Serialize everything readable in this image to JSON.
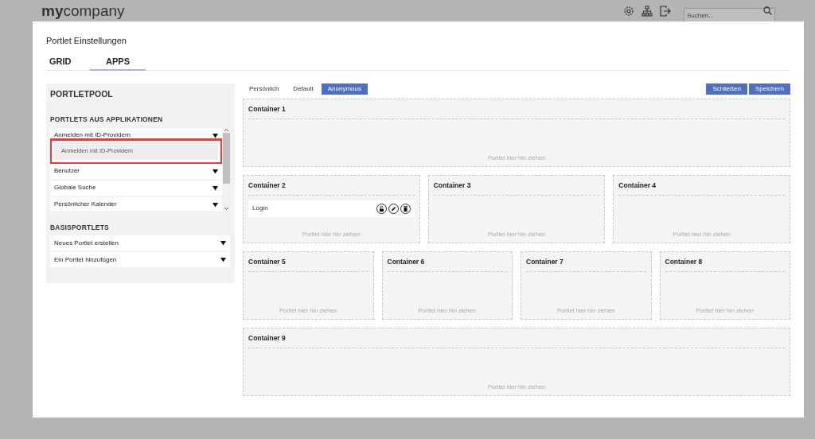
{
  "header": {
    "logo": "**my**company",
    "search": {
      "placeholder": "Suchen..."
    }
  },
  "dialog": {
    "title": "Portlet Einstellungen",
    "tabs": [
      {
        "label": "GRID",
        "selected": false
      },
      {
        "label": "APPS",
        "selected": true
      }
    ],
    "portletpool": {
      "title": "PORTLETPOOL",
      "sections": [
        {
          "title": "PORTLETS AUS APPLIKATIONEN",
          "scrollable": true,
          "items": [
            {
              "label": "Anmelden mit ID-Providern",
              "expanded": true,
              "children": [
                {
                  "label": "Anmelden mit ID-Providern",
                  "highlighted": true
                }
              ]
            },
            {
              "label": "Benutzer",
              "expanded": false
            },
            {
              "label": "Globale Suche",
              "expanded": false
            },
            {
              "label": "Persönlicher Kalender",
              "expanded": false
            }
          ]
        },
        {
          "title": "BASISPORTLETS",
          "scrollable": false,
          "items": [
            {
              "label": "Neues Portlet erstellen",
              "expanded": false
            },
            {
              "label": "Ein Portlet hinzufügen",
              "expanded": false
            }
          ]
        }
      ]
    },
    "views": [
      {
        "label": "Persönlich",
        "selected": false
      },
      {
        "label": "Default",
        "selected": false
      },
      {
        "label": "Anonymous",
        "selected": true
      }
    ],
    "buttons": [
      "Schließen",
      "Speichern"
    ],
    "container_rows": [
      [
        {
          "title": "Container 1",
          "placeholder": "Portlet hier hin ziehen"
        }
      ],
      [
        {
          "title": "Container 2",
          "portlets": [
            {
              "name": "Login"
            }
          ],
          "placeholder": "Portlet hier hin ziehen"
        },
        {
          "title": "Container 3",
          "placeholder": "Portlet hier hin ziehen"
        },
        {
          "title": "Container 4",
          "placeholder": "Portlet hier hin ziehen"
        }
      ],
      [
        {
          "title": "Container 5",
          "placeholder": "Portlet hier hin ziehen"
        },
        {
          "title": "Container 6",
          "placeholder": "Portlet hier hin ziehen"
        },
        {
          "title": "Container 7",
          "placeholder": "Portlet hier hin ziehen"
        },
        {
          "title": "Container 8",
          "placeholder": "Portlet hier hin ziehen"
        }
      ],
      [
        {
          "title": "Container 9",
          "placeholder": "Portlet hier hin ziehen"
        }
      ]
    ]
  }
}
